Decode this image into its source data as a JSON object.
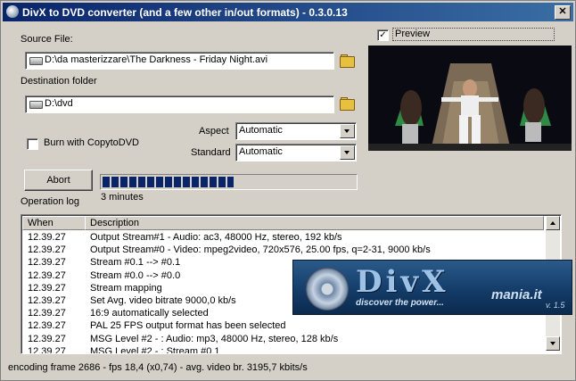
{
  "window": {
    "title": "DivX to DVD converter (and a few other in/out formats) - 0.3.0.13",
    "close_label": "✕"
  },
  "source": {
    "label": "Source File:",
    "value": "D:\\da masterizzare\\The Darkness - Friday Night.avi"
  },
  "destination": {
    "label": "Destination folder",
    "value": "D:\\dvd"
  },
  "preview": {
    "label": "Preview",
    "checked": true
  },
  "burn": {
    "label": "Burn with CopytoDVD",
    "checked": false
  },
  "aspect": {
    "label": "Aspect",
    "value": "Automatic"
  },
  "standard": {
    "label": "Standard",
    "value": "Automatic"
  },
  "abort_label": "Abort",
  "progress": {
    "fraction": 0.52,
    "time_text": "3 minutes"
  },
  "operation_log_label": "Operation log",
  "log": {
    "columns": [
      "When",
      "Description"
    ],
    "rows": [
      [
        "12.39.27",
        "Output Stream#1 - Audio: ac3, 48000 Hz, stereo, 192 kb/s"
      ],
      [
        "12.39.27",
        "Output Stream#0 - Video: mpeg2video, 720x576, 25.00 fps, q=2-31, 9000 kb/s"
      ],
      [
        "12.39.27",
        "Stream #0.1 --> #0.1"
      ],
      [
        "12.39.27",
        "Stream #0.0 --> #0.0"
      ],
      [
        "12.39.27",
        "Stream mapping"
      ],
      [
        "12.39.27",
        "Set Avg. video bitrate 9000,0 kb/s"
      ],
      [
        "12.39.27",
        "16:9 automatically selected"
      ],
      [
        "12.39.27",
        "PAL 25 FPS output format has been selected"
      ],
      [
        "12.39.27",
        "MSG Level #2 - : Audio: mp3, 48000 Hz, stereo, 128 kb/s"
      ],
      [
        "12.39.27",
        "MSG Level #2 - : Stream #0.1"
      ]
    ]
  },
  "banner": {
    "brand": "DivX",
    "site": "mania.it",
    "tagline": "discover the power...",
    "version": "v. 1.5"
  },
  "status_text": "encoding frame 2686 - fps 18,4 (x0,74) - avg. video br. 3195,7 kbits/s",
  "colors": {
    "titlebar": "#0a246a",
    "progress": "#0a246a",
    "folder": "#e8c040"
  }
}
